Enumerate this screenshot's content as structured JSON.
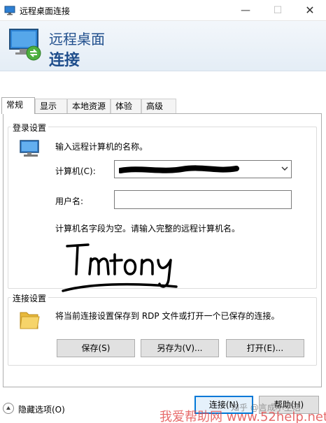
{
  "window": {
    "title": "远程桌面连接",
    "minimize_glyph": "—",
    "maximize_glyph": "☐",
    "close_glyph": "✕"
  },
  "banner": {
    "line1": "远程桌面",
    "line2": "连接"
  },
  "tabs": [
    {
      "label": "常规",
      "active": true
    },
    {
      "label": "显示",
      "active": false
    },
    {
      "label": "本地资源",
      "active": false
    },
    {
      "label": "体验",
      "active": false
    },
    {
      "label": "高级",
      "active": false
    }
  ],
  "login": {
    "group_title": "登录设置",
    "instruction": "输入远程计算机的名称。",
    "computer_label": "计算机(C):",
    "computer_value": "",
    "username_label": "用户名:",
    "username_value": "",
    "hint": "计算机名字段为空。请输入完整的远程计算机名。"
  },
  "connection": {
    "group_title": "连接设置",
    "description": "将当前连接设置保存到 RDP 文件或打开一个已保存的连接。",
    "save_label": "保存(S)",
    "save_as_label": "另存为(V)...",
    "open_label": "打开(E)..."
  },
  "footer": {
    "hide_options_label": "隐藏选项(O)",
    "connect_label": "连接(N)",
    "help_label": "帮助(H)"
  },
  "watermarks": {
    "zhihu": "知乎 @言成小生活",
    "site": "我爱帮助网 www.52help.net"
  },
  "colors": {
    "accent": "#0078d7",
    "banner_text": "#1f4e8c",
    "watermark_red": "#e14646"
  }
}
